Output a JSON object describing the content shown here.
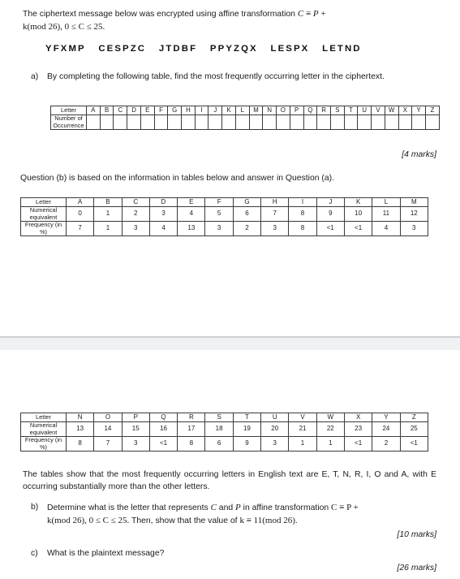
{
  "document": {
    "intro": {
      "line_pre": "The ciphertext message below was encrypted using affine transformation ",
      "math_c": "C",
      "math_equiv": " ≡ ",
      "math_p": "P",
      "math_plus": " +",
      "line2_math": "k(mod 26), 0 ≤ C ≤ 25."
    },
    "ciphertext": "YFXMP   CESPZC   JTDBF   PPYZQX   LESPX   LETND",
    "questions": [
      {
        "label": "a)",
        "text": "By completing the following table, find the most frequently occurring letter in the ciphertext.",
        "marks": "[4 marks]"
      },
      {
        "label": "b)",
        "text_pre": "Determine what is the letter that represents ",
        "text_c": "C",
        "text_mid": " and ",
        "text_p": "P",
        "text_post": " in affine transformation ",
        "text_formula1": "C ≡ P +",
        "text_line2_math": "k(mod 26), 0 ≤ C ≤ 25.",
        "text_line2_mid": " Then, show that the value of ",
        "text_line2_k": "k ≡ 11(mod 26)",
        "text_line2_end": ".",
        "marks": "[10 marks]"
      },
      {
        "label": "c)",
        "text": "What is the plaintext message?",
        "marks": "[26 marks]"
      }
    ],
    "note_tables": "Question (b) is based on the information in tables below and answer in Question (a).",
    "summary": "The tables show that the most frequently occurring letters in English text are E, T, N, R, I, O and A, with E occurring substantially more than the other letters."
  },
  "tables": {
    "occurrence": {
      "row_headers": [
        "Letter",
        "Number of Occurrence"
      ],
      "letters": [
        "A",
        "B",
        "C",
        "D",
        "E",
        "F",
        "G",
        "H",
        "I",
        "J",
        "K",
        "L",
        "M",
        "N",
        "O",
        "P",
        "Q",
        "R",
        "S",
        "T",
        "U",
        "V",
        "W",
        "X",
        "Y",
        "Z"
      ],
      "counts": [
        "",
        "",
        "",
        "",
        "",
        "",
        "",
        "",
        "",
        "",
        "",
        "",
        "",
        "",
        "",
        "",
        "",
        "",
        "",
        "",
        "",
        "",
        "",
        "",
        "",
        ""
      ]
    },
    "frequency_a_m": {
      "row_headers": [
        "Letter",
        "Numerical equivalent",
        "Frequency (in %)"
      ],
      "letters": [
        "A",
        "B",
        "C",
        "D",
        "E",
        "F",
        "G",
        "H",
        "I",
        "J",
        "K",
        "L",
        "M"
      ],
      "numerical": [
        "0",
        "1",
        "2",
        "3",
        "4",
        "5",
        "6",
        "7",
        "8",
        "9",
        "10",
        "11",
        "12"
      ],
      "frequency": [
        "7",
        "1",
        "3",
        "4",
        "13",
        "3",
        "2",
        "3",
        "8",
        "<1",
        "<1",
        "4",
        "3"
      ]
    },
    "frequency_n_z": {
      "row_headers": [
        "Letter",
        "Numerical equivalent",
        "Frequency (in %)"
      ],
      "letters": [
        "N",
        "O",
        "P",
        "Q",
        "R",
        "S",
        "T",
        "U",
        "V",
        "W",
        "X",
        "Y",
        "Z"
      ],
      "numerical": [
        "13",
        "14",
        "15",
        "16",
        "17",
        "18",
        "19",
        "20",
        "21",
        "22",
        "23",
        "24",
        "25"
      ],
      "frequency": [
        "8",
        "7",
        "3",
        "<1",
        "8",
        "6",
        "9",
        "3",
        "1",
        "1",
        "<1",
        "2",
        "<1"
      ]
    }
  },
  "chart_data": {
    "type": "table",
    "title": "English letter frequency (in %)",
    "categories": [
      "A",
      "B",
      "C",
      "D",
      "E",
      "F",
      "G",
      "H",
      "I",
      "J",
      "K",
      "L",
      "M",
      "N",
      "O",
      "P",
      "Q",
      "R",
      "S",
      "T",
      "U",
      "V",
      "W",
      "X",
      "Y",
      "Z"
    ],
    "series": [
      {
        "name": "Numerical equivalent",
        "values": [
          0,
          1,
          2,
          3,
          4,
          5,
          6,
          7,
          8,
          9,
          10,
          11,
          12,
          13,
          14,
          15,
          16,
          17,
          18,
          19,
          20,
          21,
          22,
          23,
          24,
          25
        ]
      },
      {
        "name": "Frequency (in %)",
        "values": [
          7,
          1,
          3,
          4,
          13,
          3,
          2,
          3,
          8,
          0.5,
          0.5,
          4,
          3,
          8,
          7,
          3,
          0.5,
          8,
          6,
          9,
          3,
          1,
          1,
          0.5,
          2,
          0.5
        ]
      }
    ],
    "xlabel": "Letter",
    "ylabel": "Frequency (in %)",
    "ylim": [
      0,
      13
    ],
    "grid": true,
    "legend": "none"
  },
  "style": {
    "band_line_color": "#d0d0d2",
    "band_fill_color": "#f0f1f3",
    "text_color": "#1b1b1b",
    "table_border_color": "#3a3a3a"
  }
}
